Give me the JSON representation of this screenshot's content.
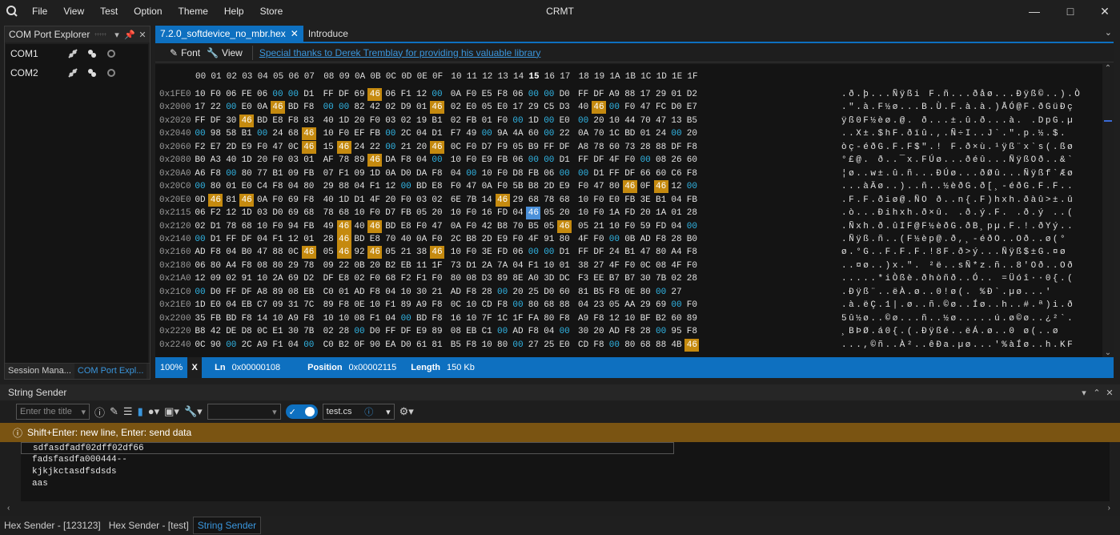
{
  "app": {
    "title": "CRMT"
  },
  "menu": [
    "File",
    "View",
    "Test",
    "Option",
    "Theme",
    "Help",
    "Store"
  ],
  "left_panel": {
    "title": "COM Port Explorer",
    "ports": [
      {
        "label": "COM1"
      },
      {
        "label": "COM2"
      }
    ],
    "tabs": [
      "Session Mana...",
      "COM Port Expl..."
    ]
  },
  "editor": {
    "tabs": [
      "7.2.0_softdevice_no_mbr.hex",
      "Introduce"
    ],
    "toolbar": {
      "font": "Font",
      "view": "View",
      "link": "Special thanks to Derek Tremblay for providing his valuable library"
    },
    "columns": [
      "00",
      "01",
      "02",
      "03",
      "04",
      "05",
      "06",
      "07",
      "08",
      "09",
      "0A",
      "0B",
      "0C",
      "0D",
      "0E",
      "0F",
      "10",
      "11",
      "12",
      "13",
      "14",
      "15",
      "16",
      "17",
      "18",
      "19",
      "1A",
      "1B",
      "1C",
      "1D",
      "1E",
      "1F"
    ],
    "rows": [
      {
        "addr": "0x1FE0",
        "bytes": "10 F0 06 FE 06 00 00 D1 FF DF 69 46 06 F1 12 00 0A F0 E5 F8 06 00 00 D0 FF DF A9 88 17 29 01 D2",
        "ascii": ".ð.þ...Ñÿßi F.ñ...ðåø...Ðÿß©..).Ò"
      },
      {
        "addr": "0x2000",
        "bytes": "17 22 00 E0 0A 46 BD F8 00 00 82 42 02 D9 01 46 02 E0 05 E0 17 29 C5 D3 40 46 00 F0 47 FC D0 E7",
        "ascii": ".\".à.F½ø...B.Ù.F.à.à.)ÅÓ@F.ðGüÐç"
      },
      {
        "addr": "0x2020",
        "bytes": "FF DF 30 46 BD E8 F8 83 40 1D 20 F0 03 02 19 B1 02 FB 01 F0 00 1D 00 E0 00 20 10 44 70 47 13 B5",
        "ascii": "ÿß0F½èø.@. ð...±.û.ð...à. .DpG.µ"
      },
      {
        "addr": "0x2040",
        "bytes": "00 98 58 B1 00 24 68 46 10 F0 EF FB 00 2C 04 D1 F7 49 00 9A 4A 60 00 22 0A 70 1C BD 01 24 00 20",
        "ascii": "..X±.$hF.ðïû.,.Ñ÷I..J`.\".p.½.$. "
      },
      {
        "addr": "0x2060",
        "bytes": "F2 E7 2D E9 F0 47 0C 46 15 46 24 22 00 21 20 46 0C F0 D7 F9 05 B9 FF DF A8 78 60 73 28 88 DF F8",
        "ascii": "òç-éðG.F.F$\".! F.ð×ù.¹ÿß¨x`s(.ßø"
      },
      {
        "addr": "0x2080",
        "bytes": "B0 A3 40 1D 20 F0 03 01 AF 78 89 46 DA F8 04 00 10 F0 E9 FB 06 00 00 D1 FF DF 4F F0 00 08 26 60",
        "ascii": "°£@. ð..¯x.FÚø...ðéû...ÑÿßOð..&`"
      },
      {
        "addr": "0x20A0",
        "bytes": "A6 F8 00 80 77 B1 09 FB 07 F1 09 1D 0A D0 DA F8 04 00 10 F0 D8 FB 06 00 00 D1 FF DF 66 60 C6 F8",
        "ascii": "¦ø..w±.û.ñ...ÐÚø...ðØû...Ñÿßf`Æø"
      },
      {
        "addr": "0x20C0",
        "bytes": "00 80 01 E0 C4 F8 04 80 29 88 04 F1 12 00 BD E8 F0 47 0A F0 5B B8 2D E9 F0 47 80 46 0F 46 12 00",
        "ascii": "...àÄø..)..ñ..½èðG.ð[¸-éðG.F.F.."
      },
      {
        "addr": "0x20E0",
        "bytes": "0D 46 81 46 0A F0 69 F8 40 1D D1 4F 20 F0 03 02 6E 7B 14 46 29 68 78 68 10 F0 E0 FB 3E B1 04 FB",
        "ascii": ".F.F.ðiø@.ÑO ð..n{.F)hxh.ðàû>±.û"
      },
      {
        "addr": "0x2115",
        "bytes": "06 F2 12 1D 03 D0 69 68 78 68 10 F0 D7 FB 05 20 10 F0 16 FD 04 46 05 20 10 F0 1A FD 20 1A 01 28",
        "ascii": ".ò...Ðihxh.ð×û. .ð.ý.F. .ð.ý ..("
      },
      {
        "addr": "0x2120",
        "bytes": "02 D1 78 68 10 F0 94 FB 49 46 40 46 BD E8 F0 47 0A F0 42 B8 70 B5 05 46 05 21 10 F0 59 FD 04 00",
        "ascii": ".Ñxh.ð.ûIF@F½èðG.ðB¸pµ.F.!.ðYý.."
      },
      {
        "addr": "0x2140",
        "bytes": "00 D1 FF DF 04 F1 12 01 28 46 BD E8 70 40 0A F0 2C B8 2D E9 F0 4F 91 80 4F F0 00 0B AD F8 28 B0",
        "ascii": ".Ñÿß.ñ..(F½èp@.ð,¸-éðO..Oð..­ø(°"
      },
      {
        "addr": "0x2160",
        "bytes": "AD F8 04 B0 47 88 0C 46 05 46 92 46 05 21 38 46 10 F0 3E FD 06 00 00 D1 FF DF 24 B1 47 80 A4 F8",
        "ascii": "­ø.°G..F.F.F.!8F.ð>ý...Ñÿß$±G.¤ø"
      },
      {
        "addr": "0x2180",
        "bytes": "06 80 A4 F8 08 80 29 78 09 22 0B 20 B2 EB 11 1F 73 D1 2A 7A 04 F1 10 01 38 27 4F F0 0C 08 4F F0",
        "ascii": "..¤ø..)x.\". ²ë..sÑ*z.ñ..8'Oð..Oð"
      },
      {
        "addr": "0x21A0",
        "bytes": "12 09 02 91 10 2A 69 D2 DF E8 02 F0 68 F2 F1 F0 80 08 D3 89 8E A0 3D DC F3 EE B7 B7 30 7B 02 28",
        "ascii": ".....*iÒßè.ðhòñð..Ó.. =Üóî··0{.("
      },
      {
        "addr": "0x21C0",
        "bytes": "00 D0 FF DF A8 89 08 EB C0 01 AD F8 04 10 30 21 AD F8 28 00 20 25 D0 60 81 B5 F8 0E 80 00 27",
        "ascii": ".Ðÿß¨..ëÀ.­ø..0!­ø(. %Ð`.µø...'"
      },
      {
        "addr": "0x21E0",
        "bytes": "1D E0 04 EB C7 09 31 7C 89 F8 0E 10 F1 89 A9 F8 0C 10 CD F8 00 80 68 88 04 23 05 AA 29 69 00 F0",
        "ascii": ".à.ëÇ.1|.ø..ñ.©ø..Íø..h..#.ª)i.ð"
      },
      {
        "addr": "0x2200",
        "bytes": "35 FB BD F8 14 10 A9 F8 10 10 08 F1 04 00 BD F8 16 10 7F 1C 1F FA 80 F8 A9 F8 12 10 BF B2 60 89",
        "ascii": "5û½ø..©ø...ñ..½ø.....ú.ø©ø..¿²`."
      },
      {
        "addr": "0x2220",
        "bytes": "B8 42 DE D8 0C E1 30 7B 02 28 00 D0 FF DF E9 89 08 EB C1 00 AD F8 04 00 30 20 AD F8 28 00 95 F8",
        "ascii": "¸BÞØ.á0{.(.Ðÿßé..ëÁ.­ø..0 ­ø(..ø"
      },
      {
        "addr": "0x2240",
        "bytes": "0C 90 00 2C A9 F1 04 00 C0 B2 0F 90 EA D0 61 81 B5 F8 10 80 00 27 25 E0 CD F8 00 80 68 88 4B 46",
        "ascii": "...,©ñ..À²..êÐa.µø...'%àÍø..h.KF"
      }
    ],
    "status": {
      "zoom": "100%",
      "close": "X",
      "ln_label": "Ln",
      "ln": "0x00000108",
      "pos_label": "Position",
      "pos": "0x00002115",
      "len_label": "Length",
      "len": "150 Kb"
    }
  },
  "string_sender": {
    "title": "String Sender",
    "title_placeholder": "Enter the title",
    "script_file": "test.cs",
    "info": "Shift+Enter: new line, Enter: send data",
    "lines": [
      "sdfasdfadf02dff02df66",
      "fadsfasdfa000444--",
      "kjkjkctasdfsdsds",
      "aas"
    ]
  },
  "bottom_tabs": [
    "Hex Sender - [123123]",
    "Hex Sender - [test]",
    "String Sender"
  ],
  "colors": {
    "accent": "#0e70c0",
    "highlight": "#c58a0f",
    "zero_byte": "#31b6e6",
    "info_bar": "#7a5412"
  }
}
